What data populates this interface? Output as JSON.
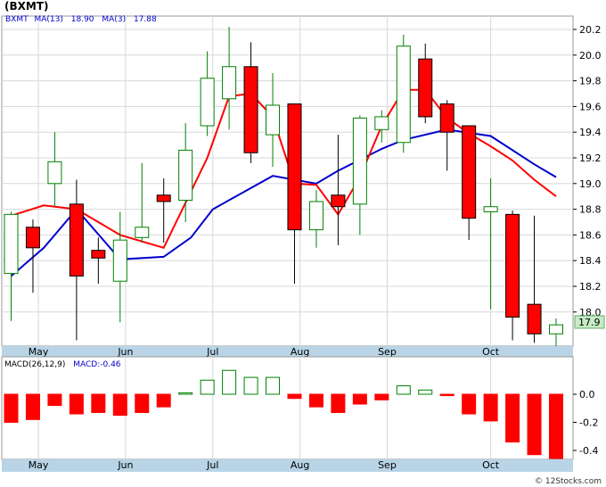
{
  "ticker": "(BXMT)",
  "watermark": "© 12Stocks.com",
  "colors": {
    "up": "#008000",
    "down": "#ff0000",
    "ma13": "#0000cc",
    "ma3": "#ff0000",
    "axis_band": "#b8d4e6",
    "grid": "#d8d8d8",
    "price_tag": "#c6ecc6"
  },
  "legend": {
    "symbol": "BXMT",
    "ma13_label": "MA(13)",
    "ma13_value": "18.90",
    "ma3_label": "MA(3)",
    "ma3_value": "17.88"
  },
  "macd_legend": {
    "label": "MACD(26,12,9)",
    "value_label": "MACD:-0.46"
  },
  "last_price_tag": "17.9",
  "month_labels": [
    "May",
    "Jun",
    "Jul",
    "Aug",
    "Sep",
    "Oct"
  ],
  "chart_data": [
    {
      "type": "candlestick",
      "title": "",
      "ylim": [
        17.65,
        20.3
      ],
      "yticks": [
        18.0,
        18.2,
        18.4,
        18.6,
        18.8,
        19.0,
        19.2,
        19.4,
        19.6,
        19.8,
        20.0,
        20.2
      ],
      "grid": true,
      "x_months": {
        "May": 1.25,
        "Jun": 5.25,
        "Jul": 9.25,
        "Aug": 13.25,
        "Sep": 17.25,
        "Oct": 22.0
      },
      "candles": [
        {
          "o": 18.3,
          "h": 18.78,
          "l": 17.93,
          "c": 18.76
        },
        {
          "o": 18.66,
          "h": 18.72,
          "l": 18.15,
          "c": 18.5
        },
        {
          "o": 19.0,
          "h": 19.4,
          "l": 18.82,
          "c": 19.17
        },
        {
          "o": 18.84,
          "h": 19.03,
          "l": 17.78,
          "c": 18.28
        },
        {
          "o": 18.48,
          "h": 18.58,
          "l": 18.22,
          "c": 18.42
        },
        {
          "o": 18.24,
          "h": 18.78,
          "l": 17.92,
          "c": 18.56
        },
        {
          "o": 18.58,
          "h": 19.16,
          "l": 18.54,
          "c": 18.66
        },
        {
          "o": 18.91,
          "h": 19.04,
          "l": 18.54,
          "c": 18.86
        },
        {
          "o": 18.87,
          "h": 19.47,
          "l": 18.7,
          "c": 19.26
        },
        {
          "o": 19.45,
          "h": 20.03,
          "l": 19.37,
          "c": 19.82
        },
        {
          "o": 19.66,
          "h": 20.22,
          "l": 19.42,
          "c": 19.91
        },
        {
          "o": 19.91,
          "h": 20.1,
          "l": 19.16,
          "c": 19.24
        },
        {
          "o": 19.38,
          "h": 19.86,
          "l": 19.13,
          "c": 19.61
        },
        {
          "o": 19.62,
          "h": 19.62,
          "l": 18.22,
          "c": 18.64
        },
        {
          "o": 18.64,
          "h": 18.95,
          "l": 18.5,
          "c": 18.86
        },
        {
          "o": 18.91,
          "h": 19.38,
          "l": 18.52,
          "c": 18.82
        },
        {
          "o": 18.84,
          "h": 19.53,
          "l": 18.6,
          "c": 19.51
        },
        {
          "o": 19.42,
          "h": 19.57,
          "l": 19.32,
          "c": 19.52
        },
        {
          "o": 19.32,
          "h": 20.16,
          "l": 19.24,
          "c": 20.07
        },
        {
          "o": 19.97,
          "h": 20.09,
          "l": 19.47,
          "c": 19.52
        },
        {
          "o": 19.62,
          "h": 19.65,
          "l": 19.1,
          "c": 19.4
        },
        {
          "o": 19.45,
          "h": 19.45,
          "l": 18.56,
          "c": 18.73
        },
        {
          "o": 18.78,
          "h": 19.04,
          "l": 18.02,
          "c": 18.82
        },
        {
          "o": 18.76,
          "h": 18.79,
          "l": 17.78,
          "c": 17.96
        },
        {
          "o": 18.06,
          "h": 18.75,
          "l": 17.76,
          "c": 17.83
        },
        {
          "o": 17.83,
          "h": 17.95,
          "l": 17.65,
          "c": 17.9
        }
      ],
      "series": [
        {
          "name": "MA(13)",
          "x": [
            0,
            1.5,
            3,
            5,
            7,
            8.25,
            9.25,
            12,
            14,
            15,
            17,
            18,
            20,
            22,
            24,
            25
          ],
          "values": [
            18.28,
            18.5,
            18.8,
            18.41,
            18.43,
            18.58,
            18.8,
            19.06,
            19.0,
            19.1,
            19.27,
            19.34,
            19.42,
            19.37,
            19.15,
            19.05
          ]
        },
        {
          "name": "MA(3)",
          "x": [
            0,
            1.5,
            3,
            5,
            7,
            9,
            10,
            11,
            12,
            13,
            14,
            15,
            16,
            17,
            18,
            19,
            20,
            21,
            22,
            23,
            24,
            25
          ],
          "values": [
            18.75,
            18.83,
            18.8,
            18.6,
            18.5,
            19.2,
            19.68,
            19.7,
            19.52,
            19.0,
            18.99,
            18.76,
            19.05,
            19.45,
            19.73,
            19.73,
            19.51,
            19.39,
            19.29,
            19.18,
            19.03,
            18.9
          ]
        }
      ]
    },
    {
      "type": "bar",
      "title": "",
      "ylim": [
        -0.47,
        0.15
      ],
      "yticks": [
        0.0,
        -0.2,
        -0.4
      ],
      "values": [
        -0.2,
        -0.18,
        -0.08,
        -0.14,
        -0.13,
        -0.15,
        -0.13,
        -0.09,
        0.01,
        0.1,
        0.17,
        0.12,
        0.12,
        -0.03,
        -0.09,
        -0.13,
        -0.07,
        -0.04,
        0.06,
        0.03,
        -0.01,
        -0.14,
        -0.19,
        -0.34,
        -0.43,
        -0.48
      ],
      "series": [
        {
          "name": "MACD",
          "values": []
        }
      ]
    }
  ]
}
